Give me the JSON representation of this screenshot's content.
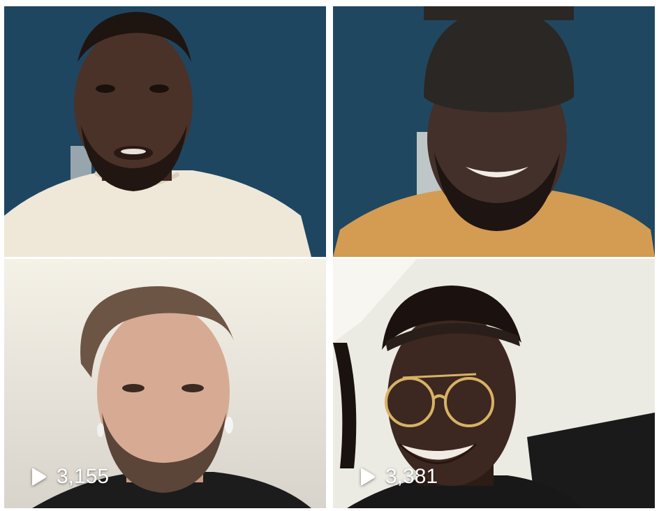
{
  "tiles": [
    {
      "id": "tile-1",
      "views": null
    },
    {
      "id": "tile-2",
      "views": null
    },
    {
      "id": "tile-3",
      "views": "3,155",
      "play_icon": "play-icon"
    },
    {
      "id": "tile-4",
      "views": "3,381",
      "play_icon": "play-icon"
    }
  ],
  "colors": {
    "wall_teal": "#1f4660",
    "wall_light": "#f2efe4",
    "overlay_text": "#ffffff"
  }
}
